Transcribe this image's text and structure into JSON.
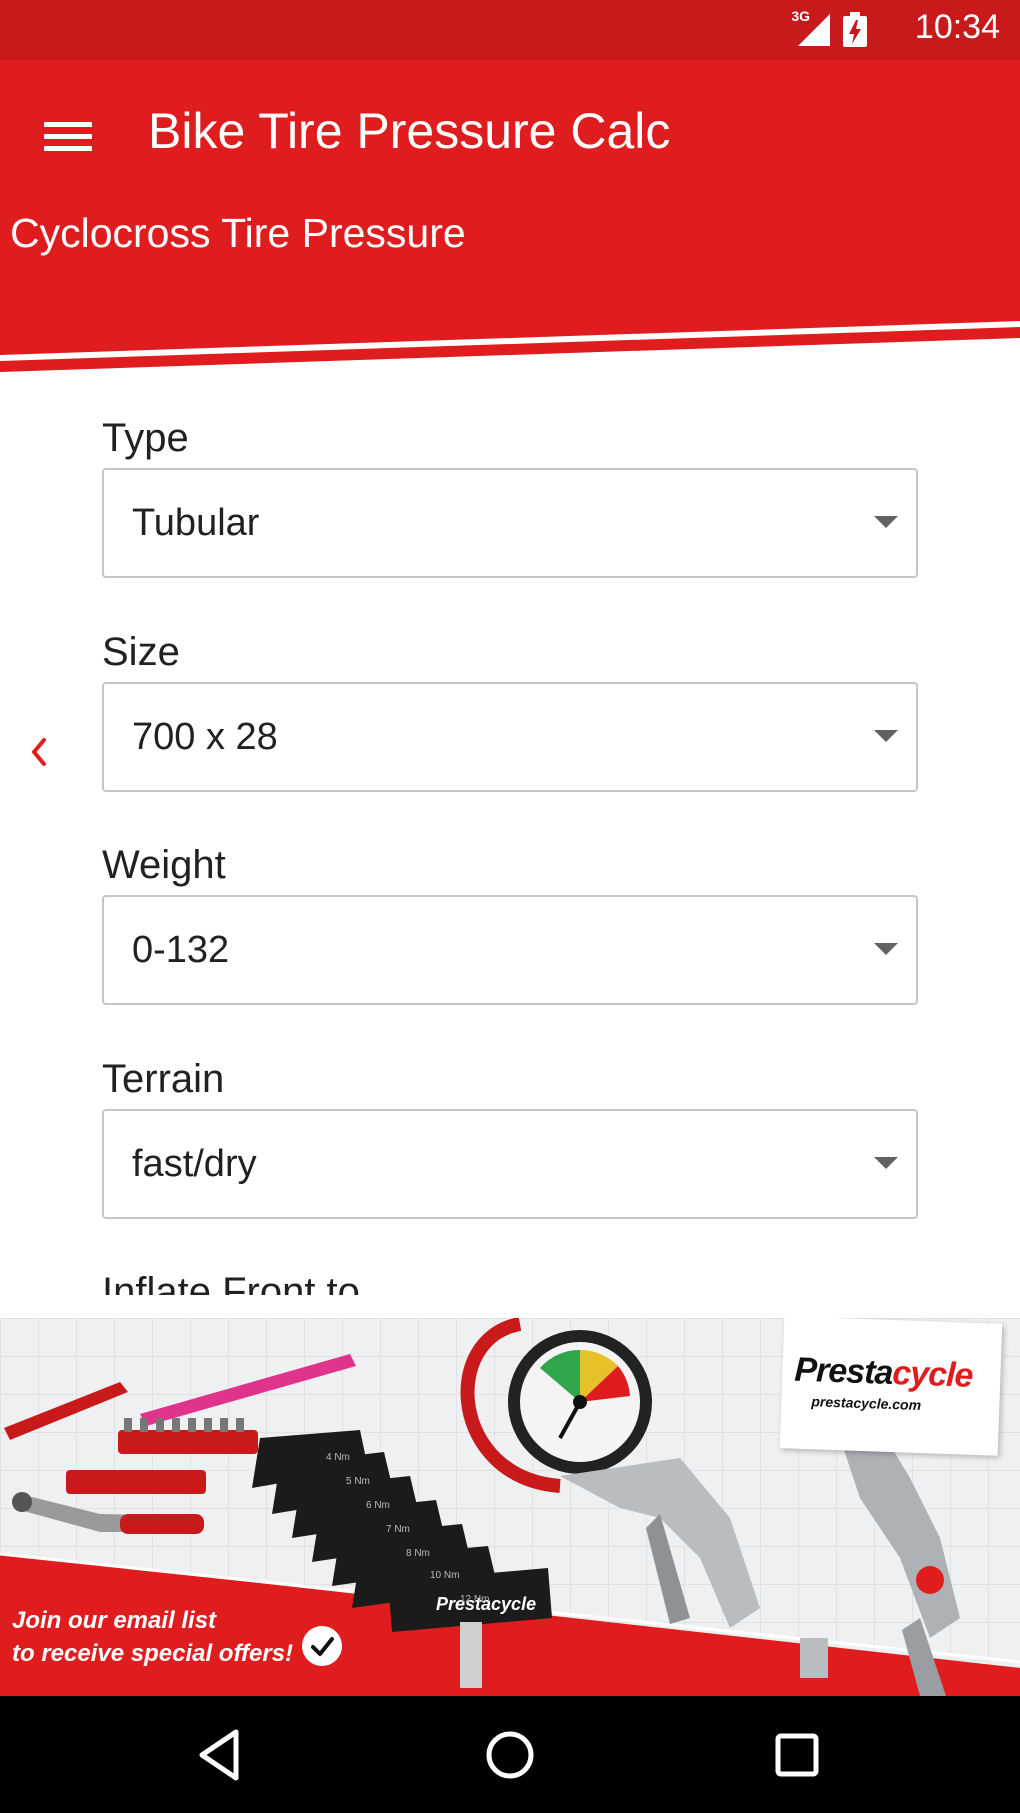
{
  "status_bar": {
    "network": "3G",
    "time": "10:34"
  },
  "app_bar": {
    "title": "Bike Tire Pressure Calc",
    "subtitle": "Cyclocross Tire Pressure"
  },
  "form": {
    "fields": [
      {
        "label": "Type",
        "value": "Tubular"
      },
      {
        "label": "Size",
        "value": "700 x 28"
      },
      {
        "label": "Weight",
        "value": "0-132"
      },
      {
        "label": "Terrain",
        "value": "fast/dry"
      }
    ],
    "next_label": "Inflate Front to"
  },
  "banner": {
    "brand_part1": "Presta",
    "brand_part2": "cycle",
    "brand_url": "prestacycle.com",
    "cta_line1": "Join our email list",
    "cta_line2": "to receive special offers!",
    "tool_labels": [
      "4 Nm",
      "5 Nm",
      "6 Nm",
      "7 Nm",
      "8 Nm",
      "10 Nm",
      "12 Nm"
    ],
    "tool_brand": "Prestacycle"
  },
  "colors": {
    "primary": "#e01d1e",
    "status": "#c8191b",
    "accent_chevron": "#e01d1e"
  },
  "icons": {
    "menu": "hamburger-menu-icon",
    "back": "chevron-left-icon",
    "dropdown": "caret-down-icon",
    "nav_back": "triangle-back-icon",
    "nav_home": "circle-home-icon",
    "nav_recents": "square-recents-icon"
  }
}
